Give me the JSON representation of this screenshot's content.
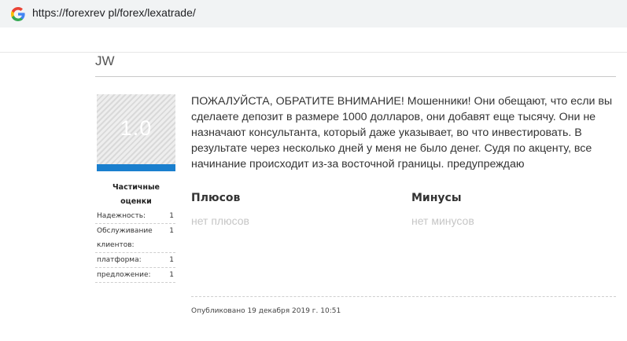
{
  "browser": {
    "url": "https://forexrev pl/forex/lexatrade/",
    "icon": "google-g-icon"
  },
  "review": {
    "author": "JW",
    "score": "1.0",
    "score_fill": 1.0,
    "score_bar_color": "#1a7fce",
    "partial_ratings_title": "Частичные оценки",
    "ratings": [
      {
        "label": "Надежность:",
        "value": "1"
      },
      {
        "label": "Обслуживание клиентов:",
        "value": "1"
      },
      {
        "label": "платформа:",
        "value": "1"
      },
      {
        "label": "предложение:",
        "value": "1"
      }
    ],
    "text": "ПОЖАЛУЙСТА, ОБРАТИТЕ ВНИМАНИЕ! Мошенники! Они обещают, что если вы сделаете депозит в размере 1000 долларов, они добавят еще тысячу. Они не назначают консультанта, который даже указывает, во что инвестировать. В результате через несколько дней у меня не было денег. Судя по акценту, все начинание происходит из-за восточной границы. предупреждаю",
    "pros_heading": "Плюсов",
    "pros_text": "нет плюсов",
    "cons_heading": "Минусы",
    "cons_text": "нет минусов",
    "published": "Опубликовано 19 декабря 2019 г. 10:51"
  }
}
